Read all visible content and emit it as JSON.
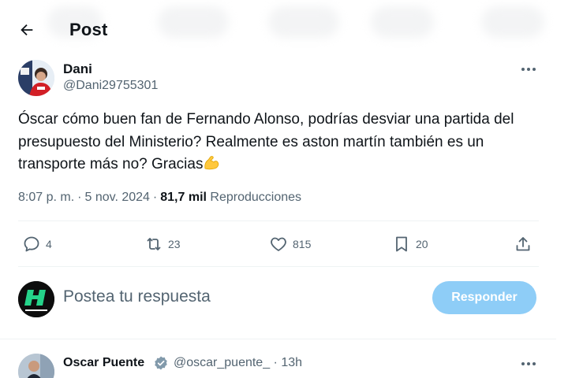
{
  "header": {
    "title": "Post"
  },
  "tweet": {
    "author_name": "Dani",
    "author_handle": "@Dani29755301",
    "text": "Óscar cómo buen fan de Fernando Alonso, podrías desviar una partida del presupuesto del Ministerio? Realmente es aston martín también es un transporte más no? Gracias",
    "emoji": "flexed-biceps-emoji",
    "time": "8:07 p. m.",
    "date": "5 nov. 2024",
    "views_count": "81,7 mil",
    "views_label": "Reproducciones",
    "stats": {
      "replies": "4",
      "reposts": "23",
      "likes": "815",
      "bookmarks": "20"
    }
  },
  "reply_composer": {
    "placeholder": "Postea tu respuesta",
    "button_label": "Responder"
  },
  "next_reply": {
    "author_name": "Oscar Puente",
    "author_handle": "@oscar_puente_",
    "time_ago": "13h"
  },
  "colors": {
    "text_primary": "#0f1419",
    "text_secondary": "#536471",
    "divider": "#eff3f4",
    "reply_button_disabled": "#8ecdf7"
  }
}
